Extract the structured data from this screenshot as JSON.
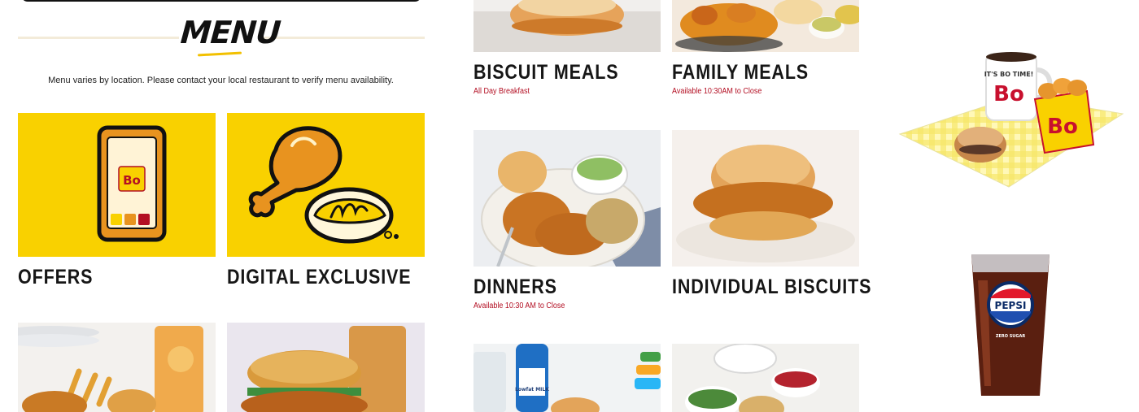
{
  "menu": {
    "title": "MENU",
    "notice": "Menu varies by location. Please contact your local restaurant to verify menu availability."
  },
  "left_tiles": [
    {
      "title": "OFFERS"
    },
    {
      "title": "DIGITAL EXCLUSIVE"
    }
  ],
  "categories": [
    {
      "title": "BISCUIT MEALS",
      "subtitle": "All Day Breakfast"
    },
    {
      "title": "FAMILY MEALS",
      "subtitle": "Available 10:30AM to Close"
    },
    {
      "title": "DINNERS",
      "subtitle": "Available 10:30 AM to Close"
    },
    {
      "title": "INDIVIDUAL BISCUITS",
      "subtitle": ""
    }
  ],
  "brand": {
    "logo": "Bo",
    "its_bo_time": "IT'S BO TIME!",
    "tater_box": "Bo",
    "drink": "PEPSI",
    "drink_sub": "ZERO SUGAR",
    "milk": "Lowfat MILK"
  },
  "colors": {
    "yellow": "#f9d100",
    "red": "#b30f23",
    "orange": "#e8931f"
  }
}
